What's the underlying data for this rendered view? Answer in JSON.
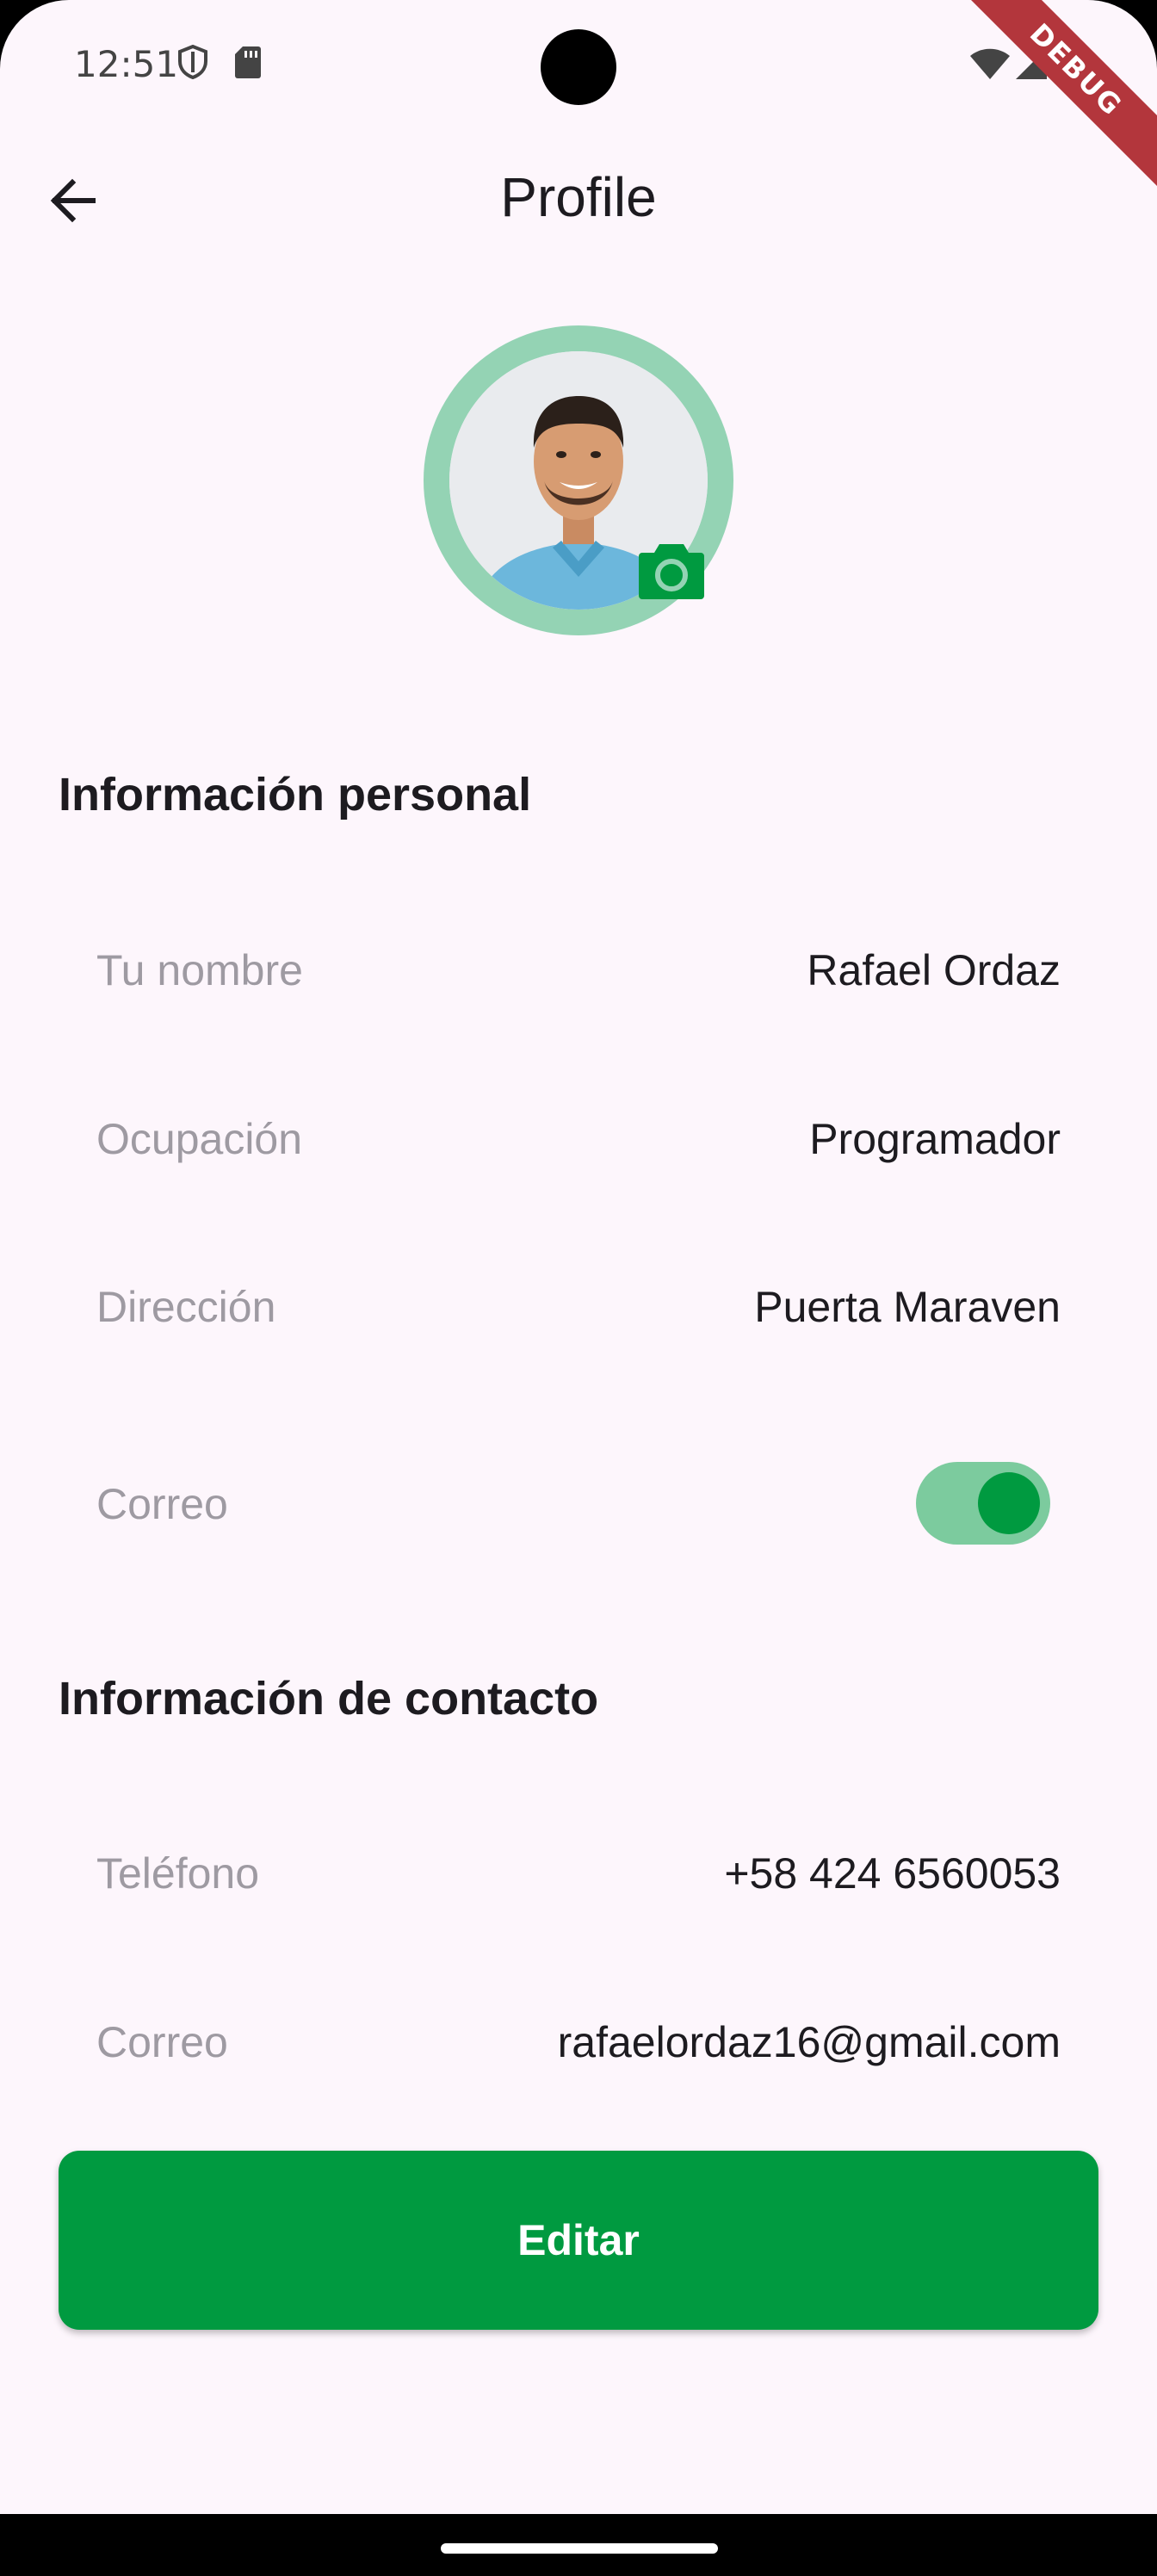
{
  "status_bar": {
    "time": "12:51"
  },
  "debug_banner": "DEBUG",
  "app_bar": {
    "title": "Profile"
  },
  "sections": {
    "personal": {
      "title": "Información personal",
      "fields": [
        {
          "label": "Tu nombre",
          "value": "Rafael Ordaz"
        },
        {
          "label": "Ocupación",
          "value": "Programador"
        },
        {
          "label": "Dirección",
          "value": "Puerta Maraven"
        },
        {
          "label": "Correo",
          "toggle_on": true
        }
      ]
    },
    "contact": {
      "title": "Información de contacto",
      "fields": [
        {
          "label": "Teléfono",
          "value": "+58 424 6560053"
        },
        {
          "label": "Correo",
          "value": "rafaelordaz16@gmail.com"
        }
      ]
    }
  },
  "edit_button": {
    "label": "Editar"
  },
  "colors": {
    "primary": "#009a40",
    "avatar_ring": "#94d3b4",
    "toggle_track": "#7ccb9e",
    "background": "#fdf6fc",
    "debug_ribbon": "#b3363c"
  },
  "icons": [
    "shield-icon",
    "sd-card-icon",
    "wifi-icon",
    "signal-icon",
    "battery-icon",
    "back-arrow-icon",
    "camera-icon"
  ]
}
